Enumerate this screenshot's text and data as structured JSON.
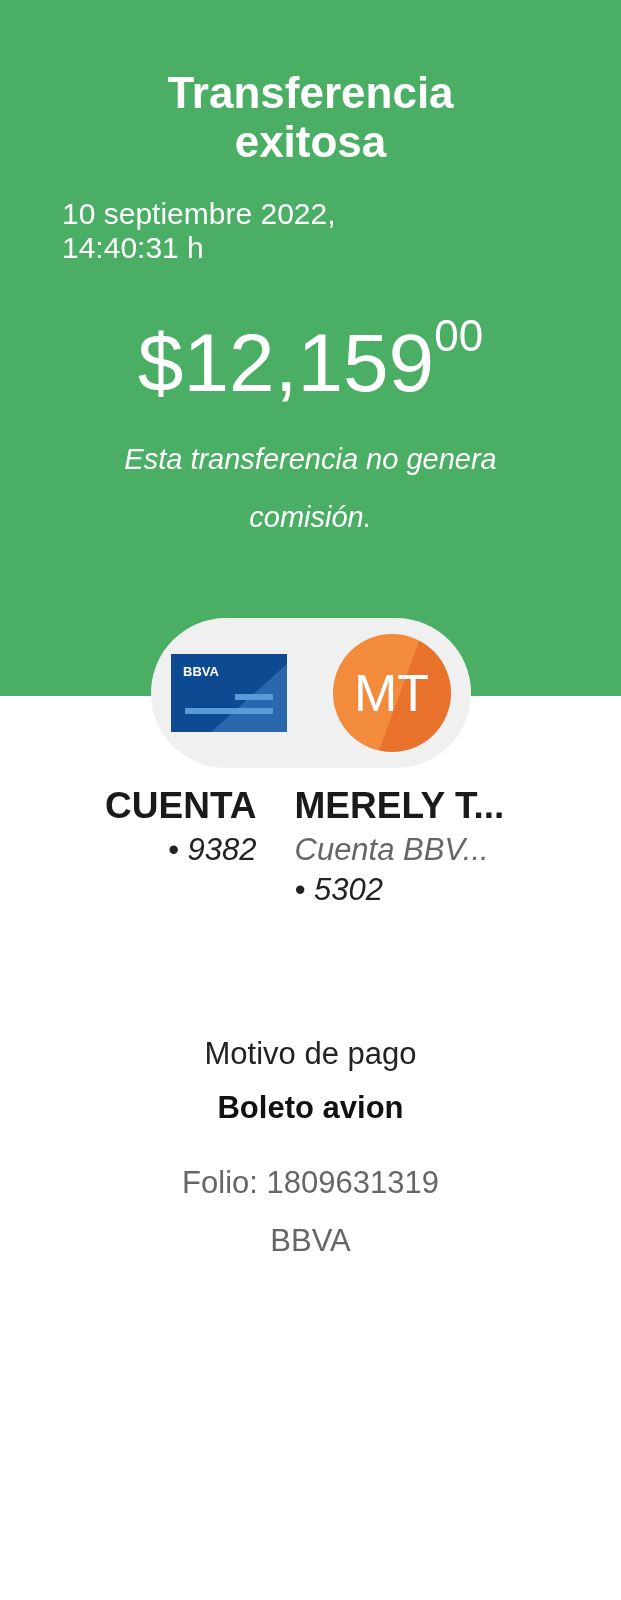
{
  "header": {
    "title": "Transferencia exitosa",
    "date": "10 septiembre 2022, 14:40:31 h",
    "amount": "$12,159$^{00}$",
    "note": "Esta transferencia no genera comisión."
  },
  "origin": {
    "card_label": "BBVA",
    "name": "CUENTA",
    "number": "• 9382"
  },
  "destination": {
    "initials": "MT",
    "name": "MERELY T...",
    "bank": "Cuenta BBV...",
    "number": "• 5302"
  },
  "details": {
    "reason_label": "Motivo de pago",
    "reason": "Boleto avion",
    "folio": "Folio: 1809631319",
    "bank": "BBVA"
  }
}
